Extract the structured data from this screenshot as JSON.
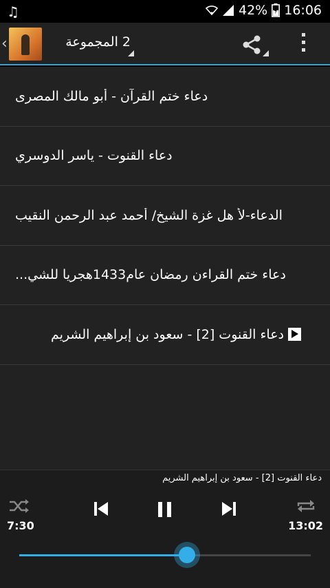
{
  "status_bar": {
    "battery": "42%",
    "time": "16:06",
    "icons": [
      "music-note-icon",
      "wifi-icon",
      "signal-icon",
      "battery-icon"
    ]
  },
  "action_bar": {
    "title": "2 المجموعة",
    "icons": [
      "up-caret-icon",
      "app-icon",
      "share-icon",
      "overflow-menu-icon"
    ]
  },
  "list": {
    "items": [
      {
        "label": "دعاء ختم القرآن - أبو مالك المصرى",
        "playing": false
      },
      {
        "label": "دعاء القنوت - ياسر الدوسري",
        "playing": false
      },
      {
        "label": "الدعاء-لأ هل غزة الشيخ/ أحمد عبد الرحمن النقيب",
        "playing": false
      },
      {
        "label": "دعاء ختم القراءن رمضان عام1433هجريا للشي...",
        "playing": false
      },
      {
        "label": "دعاء القنوت [2] - سعود بن إبراهيم الشريم",
        "playing": true
      }
    ]
  },
  "player": {
    "now_playing": "دعاء القنوت [2] - سعود بن إبراهيم الشريم",
    "elapsed": "7:30",
    "duration": "13:02",
    "progress": 0.575,
    "icons": [
      "shuffle-icon",
      "previous-icon",
      "pause-icon",
      "next-icon",
      "repeat-icon"
    ]
  },
  "colors": {
    "accent": "#33aee8",
    "background": "#222222"
  }
}
